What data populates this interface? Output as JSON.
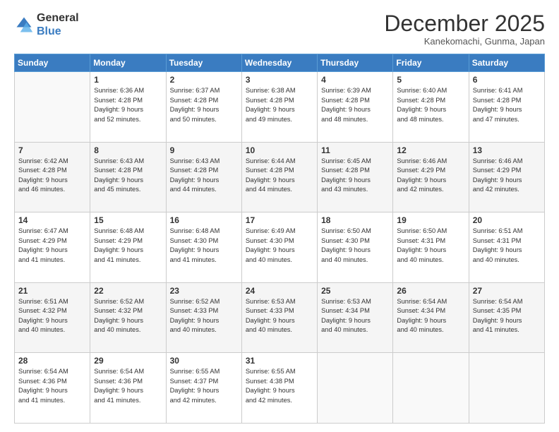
{
  "header": {
    "logo_general": "General",
    "logo_blue": "Blue",
    "month_title": "December 2025",
    "subtitle": "Kanekomachi, Gunma, Japan"
  },
  "days_of_week": [
    "Sunday",
    "Monday",
    "Tuesday",
    "Wednesday",
    "Thursday",
    "Friday",
    "Saturday"
  ],
  "weeks": [
    [
      {
        "day": "",
        "info": ""
      },
      {
        "day": "1",
        "info": "Sunrise: 6:36 AM\nSunset: 4:28 PM\nDaylight: 9 hours\nand 52 minutes."
      },
      {
        "day": "2",
        "info": "Sunrise: 6:37 AM\nSunset: 4:28 PM\nDaylight: 9 hours\nand 50 minutes."
      },
      {
        "day": "3",
        "info": "Sunrise: 6:38 AM\nSunset: 4:28 PM\nDaylight: 9 hours\nand 49 minutes."
      },
      {
        "day": "4",
        "info": "Sunrise: 6:39 AM\nSunset: 4:28 PM\nDaylight: 9 hours\nand 48 minutes."
      },
      {
        "day": "5",
        "info": "Sunrise: 6:40 AM\nSunset: 4:28 PM\nDaylight: 9 hours\nand 48 minutes."
      },
      {
        "day": "6",
        "info": "Sunrise: 6:41 AM\nSunset: 4:28 PM\nDaylight: 9 hours\nand 47 minutes."
      }
    ],
    [
      {
        "day": "7",
        "info": "Sunrise: 6:42 AM\nSunset: 4:28 PM\nDaylight: 9 hours\nand 46 minutes."
      },
      {
        "day": "8",
        "info": "Sunrise: 6:43 AM\nSunset: 4:28 PM\nDaylight: 9 hours\nand 45 minutes."
      },
      {
        "day": "9",
        "info": "Sunrise: 6:43 AM\nSunset: 4:28 PM\nDaylight: 9 hours\nand 44 minutes."
      },
      {
        "day": "10",
        "info": "Sunrise: 6:44 AM\nSunset: 4:28 PM\nDaylight: 9 hours\nand 44 minutes."
      },
      {
        "day": "11",
        "info": "Sunrise: 6:45 AM\nSunset: 4:28 PM\nDaylight: 9 hours\nand 43 minutes."
      },
      {
        "day": "12",
        "info": "Sunrise: 6:46 AM\nSunset: 4:29 PM\nDaylight: 9 hours\nand 42 minutes."
      },
      {
        "day": "13",
        "info": "Sunrise: 6:46 AM\nSunset: 4:29 PM\nDaylight: 9 hours\nand 42 minutes."
      }
    ],
    [
      {
        "day": "14",
        "info": "Sunrise: 6:47 AM\nSunset: 4:29 PM\nDaylight: 9 hours\nand 41 minutes."
      },
      {
        "day": "15",
        "info": "Sunrise: 6:48 AM\nSunset: 4:29 PM\nDaylight: 9 hours\nand 41 minutes."
      },
      {
        "day": "16",
        "info": "Sunrise: 6:48 AM\nSunset: 4:30 PM\nDaylight: 9 hours\nand 41 minutes."
      },
      {
        "day": "17",
        "info": "Sunrise: 6:49 AM\nSunset: 4:30 PM\nDaylight: 9 hours\nand 40 minutes."
      },
      {
        "day": "18",
        "info": "Sunrise: 6:50 AM\nSunset: 4:30 PM\nDaylight: 9 hours\nand 40 minutes."
      },
      {
        "day": "19",
        "info": "Sunrise: 6:50 AM\nSunset: 4:31 PM\nDaylight: 9 hours\nand 40 minutes."
      },
      {
        "day": "20",
        "info": "Sunrise: 6:51 AM\nSunset: 4:31 PM\nDaylight: 9 hours\nand 40 minutes."
      }
    ],
    [
      {
        "day": "21",
        "info": "Sunrise: 6:51 AM\nSunset: 4:32 PM\nDaylight: 9 hours\nand 40 minutes."
      },
      {
        "day": "22",
        "info": "Sunrise: 6:52 AM\nSunset: 4:32 PM\nDaylight: 9 hours\nand 40 minutes."
      },
      {
        "day": "23",
        "info": "Sunrise: 6:52 AM\nSunset: 4:33 PM\nDaylight: 9 hours\nand 40 minutes."
      },
      {
        "day": "24",
        "info": "Sunrise: 6:53 AM\nSunset: 4:33 PM\nDaylight: 9 hours\nand 40 minutes."
      },
      {
        "day": "25",
        "info": "Sunrise: 6:53 AM\nSunset: 4:34 PM\nDaylight: 9 hours\nand 40 minutes."
      },
      {
        "day": "26",
        "info": "Sunrise: 6:54 AM\nSunset: 4:34 PM\nDaylight: 9 hours\nand 40 minutes."
      },
      {
        "day": "27",
        "info": "Sunrise: 6:54 AM\nSunset: 4:35 PM\nDaylight: 9 hours\nand 41 minutes."
      }
    ],
    [
      {
        "day": "28",
        "info": "Sunrise: 6:54 AM\nSunset: 4:36 PM\nDaylight: 9 hours\nand 41 minutes."
      },
      {
        "day": "29",
        "info": "Sunrise: 6:54 AM\nSunset: 4:36 PM\nDaylight: 9 hours\nand 41 minutes."
      },
      {
        "day": "30",
        "info": "Sunrise: 6:55 AM\nSunset: 4:37 PM\nDaylight: 9 hours\nand 42 minutes."
      },
      {
        "day": "31",
        "info": "Sunrise: 6:55 AM\nSunset: 4:38 PM\nDaylight: 9 hours\nand 42 minutes."
      },
      {
        "day": "",
        "info": ""
      },
      {
        "day": "",
        "info": ""
      },
      {
        "day": "",
        "info": ""
      }
    ]
  ]
}
